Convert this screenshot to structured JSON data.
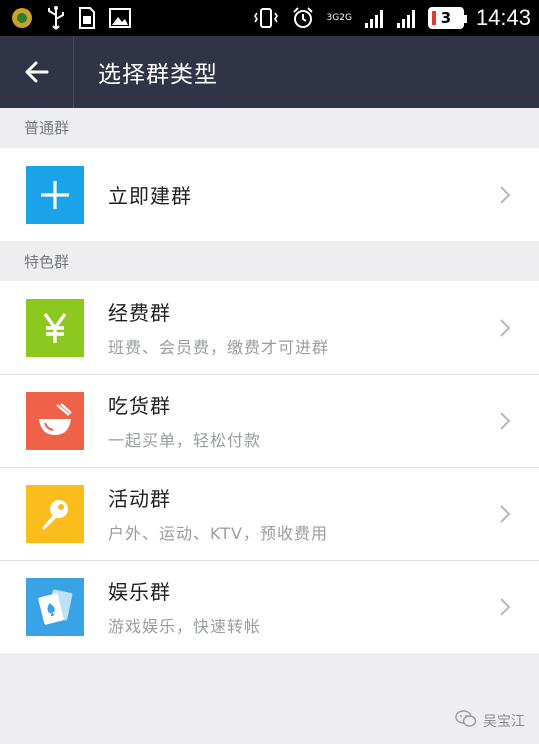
{
  "status_bar": {
    "time": "14:43",
    "battery": "3",
    "net_top": "3G",
    "net_bottom": "2G"
  },
  "header": {
    "title": "选择群类型"
  },
  "sections": [
    {
      "label": "普通群",
      "items": [
        {
          "title": "立即建群",
          "subtitle": "",
          "icon": "plus-icon",
          "color": "#1aa3e8"
        }
      ]
    },
    {
      "label": "特色群",
      "items": [
        {
          "title": "经费群",
          "subtitle": "班费、会员费，缴费才可进群",
          "icon": "yen-icon",
          "color": "#8cc820"
        },
        {
          "title": "吃货群",
          "subtitle": "一起买单，轻松付款",
          "icon": "bowl-icon",
          "color": "#f0614a"
        },
        {
          "title": "活动群",
          "subtitle": "户外、运动、KTV，预收费用",
          "icon": "pin-icon",
          "color": "#fbbd1c"
        },
        {
          "title": "娱乐群",
          "subtitle": "游戏娱乐，快速转帐",
          "icon": "playing-card-icon",
          "color": "#3aa3e6"
        }
      ]
    }
  ],
  "watermark": {
    "text": "吴宝江"
  }
}
